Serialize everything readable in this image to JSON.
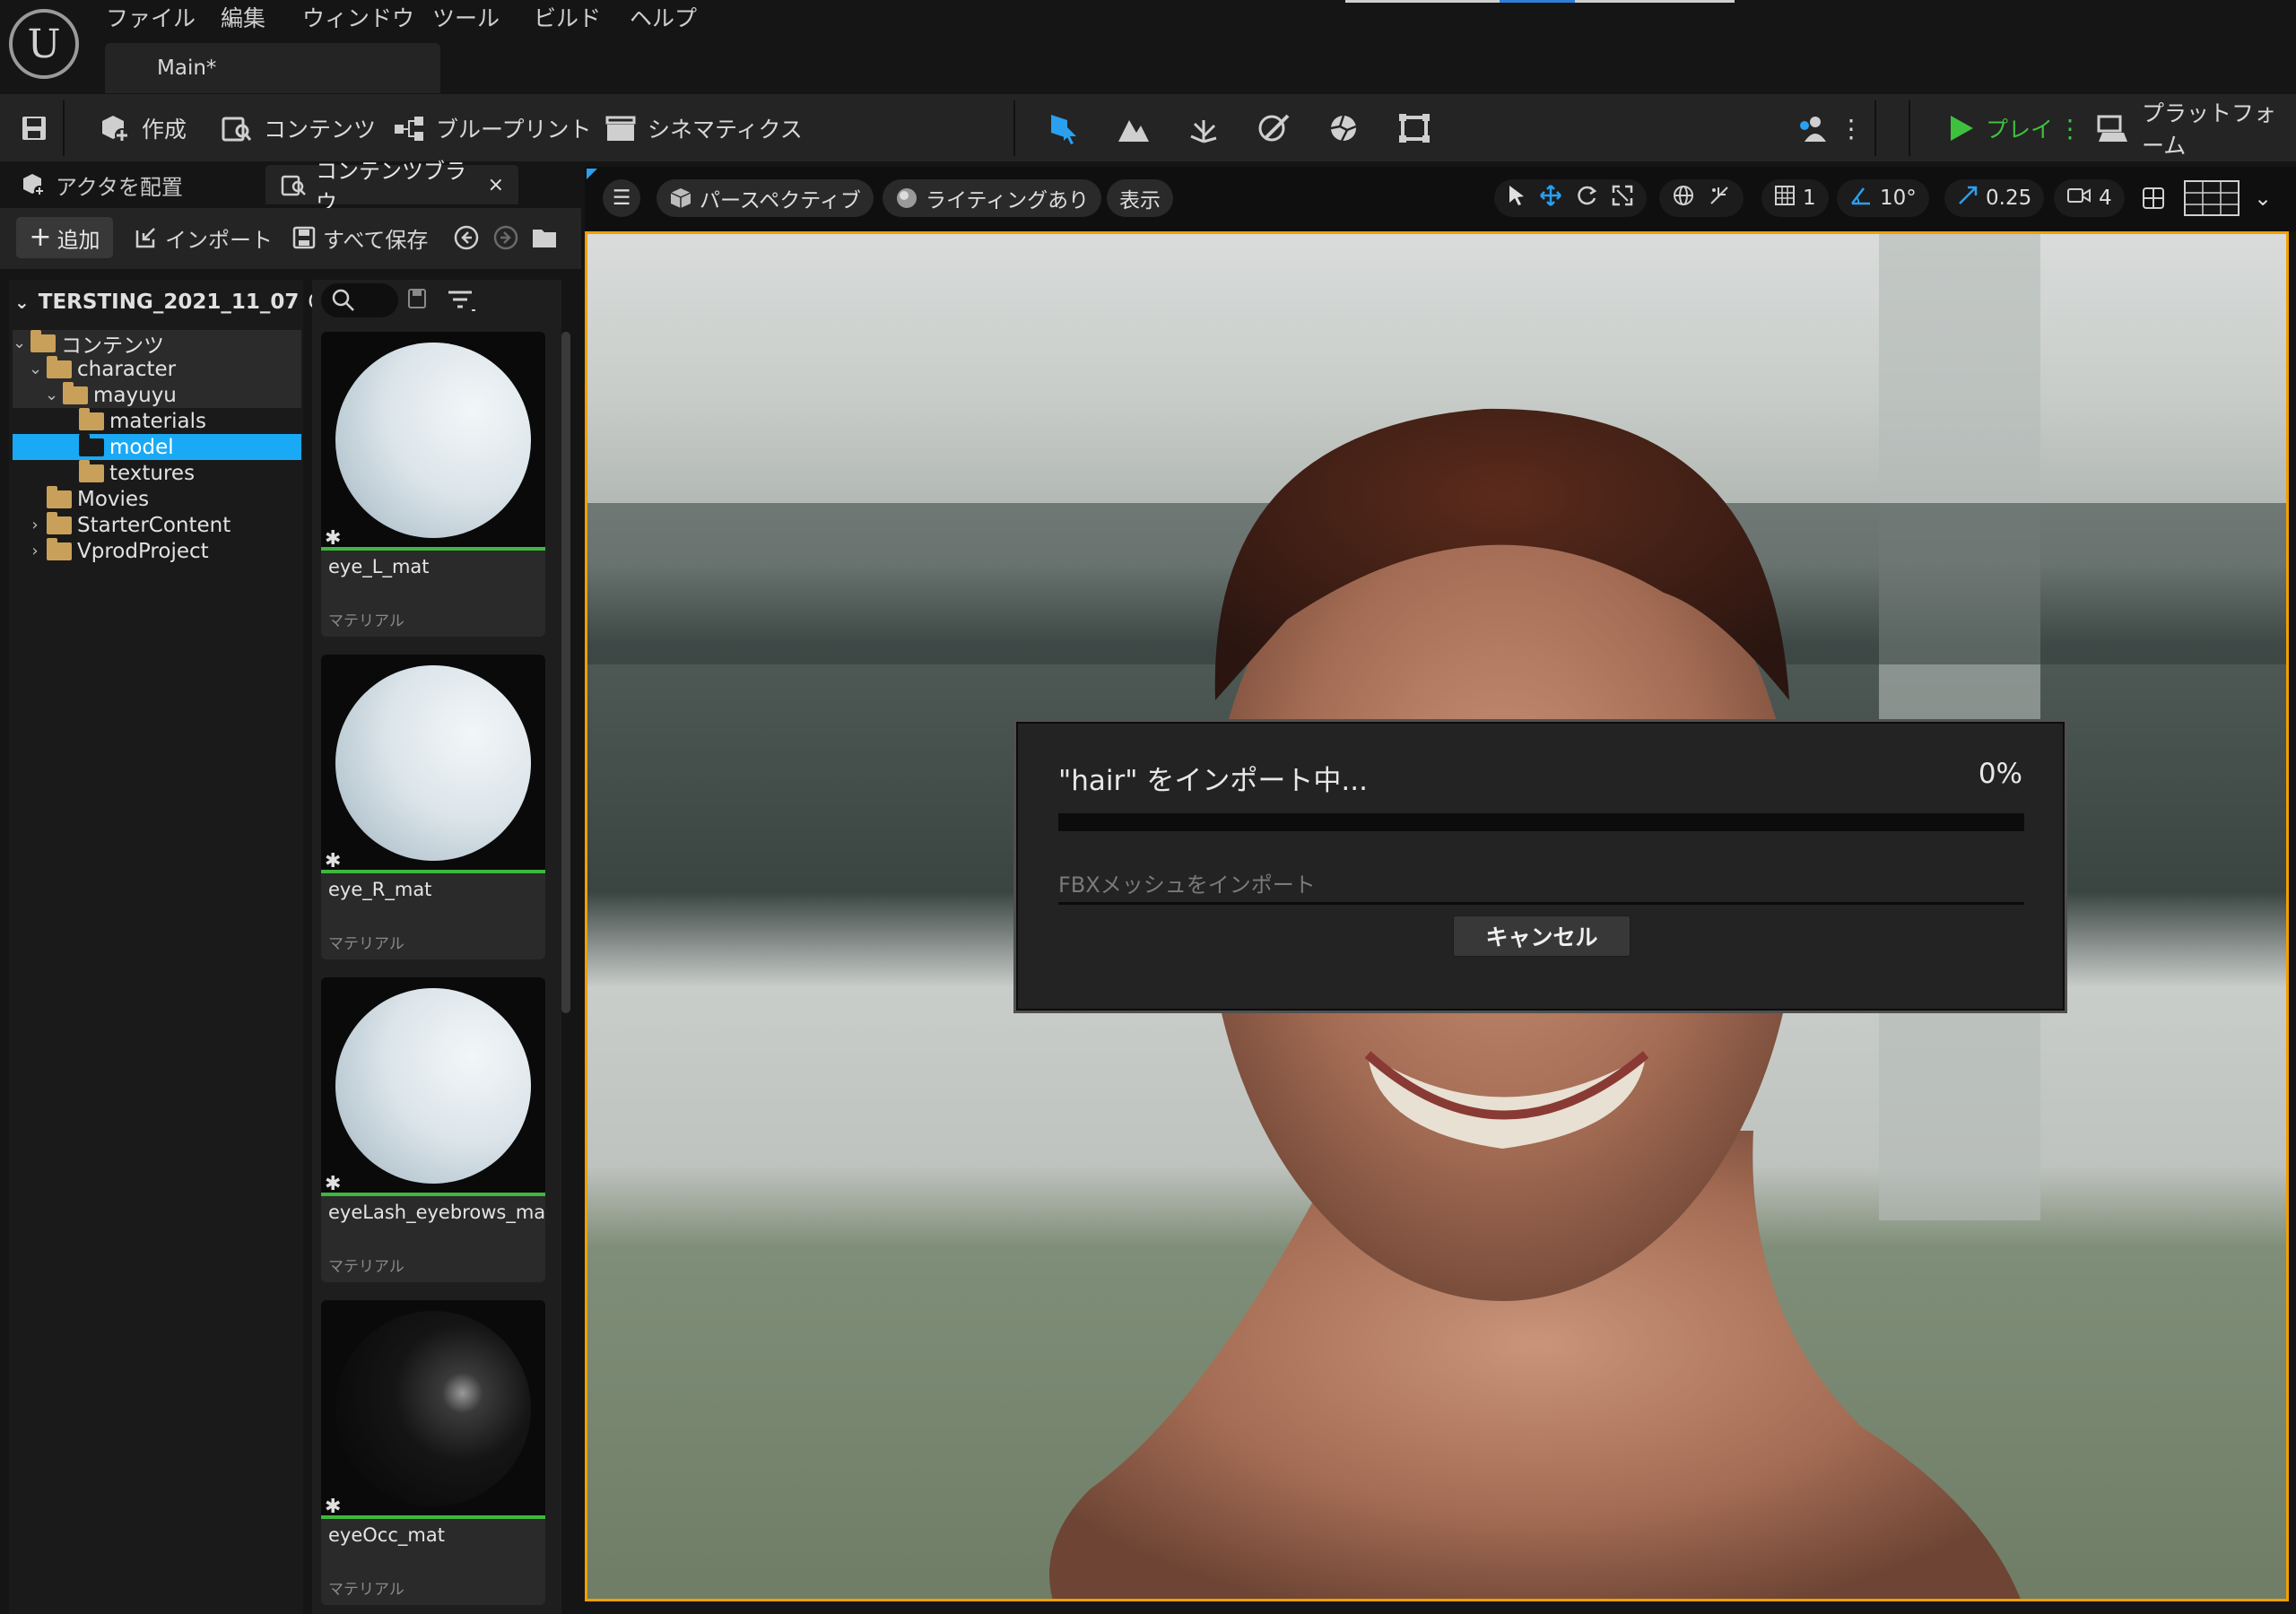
{
  "menubar": {
    "items": [
      "ファイル",
      "編集",
      "ウィンドウ",
      "ツール",
      "ビルド",
      "ヘルプ"
    ],
    "logo": "unreal-logo"
  },
  "doc_tab": {
    "label": "Main*"
  },
  "toolbar": {
    "create_label": "作成",
    "content_label": "コンテンツ",
    "blueprint_label": "ブループリント",
    "cinematics_label": "シネマティクス",
    "play_label": "プレイ",
    "platform_label": "プラットフォーム"
  },
  "panel_tabs": {
    "place_actors": "アクタを配置",
    "content_browser": "コンテンツブラウ"
  },
  "content_browser": {
    "add_label": "追加",
    "import_label": "インポート",
    "save_all_label": "すべて保存",
    "project_name": "TERSTING_2021_11_07",
    "tree": [
      {
        "label": "コンテンツ"
      },
      {
        "label": "character"
      },
      {
        "label": "mayuyu"
      },
      {
        "label": "materials"
      },
      {
        "label": "model"
      },
      {
        "label": "textures"
      },
      {
        "label": "Movies"
      },
      {
        "label": "StarterContent"
      },
      {
        "label": "VprodProject"
      }
    ],
    "assets": [
      {
        "name": "eye_L_mat",
        "type": "マテリアル"
      },
      {
        "name": "eye_R_mat",
        "type": "マテリアル"
      },
      {
        "name": "eyeLash_eyebrows_mat",
        "type": "マテリアル"
      },
      {
        "name": "eyeOcc_mat",
        "type": "マテリアル"
      }
    ]
  },
  "viewport": {
    "perspective_label": "パースペクティブ",
    "lighting_label": "ライティングあり",
    "show_label": "表示",
    "grid_value": "1",
    "angle_value": "10°",
    "scale_value": "0.25",
    "camera_speed": "4"
  },
  "import_dialog": {
    "title": "\"hair\" をインポート中...",
    "percent": "0%",
    "progress": 0,
    "subtitle": "FBXメッシュをインポート",
    "cancel_label": "キャンセル"
  },
  "colors": {
    "selection": "#1aa9f5",
    "viewport_border": "#f0a000",
    "play_green": "#3fc13f",
    "folder": "#c9a05a"
  }
}
